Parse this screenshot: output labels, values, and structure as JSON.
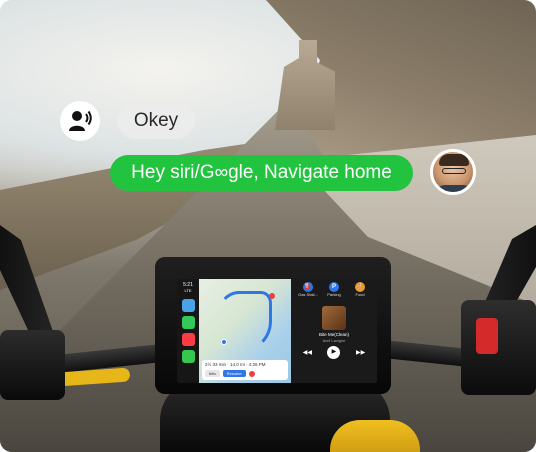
{
  "bubbles": {
    "okey": "Okey",
    "command": "Hey siri/G∞gle, Navigate home"
  },
  "device": {
    "status": {
      "time": "5:21",
      "network": "LTE"
    },
    "dock_icons": [
      "phone-icon",
      "music-icon",
      "maps-icon",
      "messages-icon"
    ],
    "map": {
      "eta": "2½ 33 min · 14.0 mi · 4:26 PM",
      "info_label": "Info",
      "resume_label": "Resume"
    },
    "quick_actions": [
      {
        "label": "Gas Stati...",
        "icon": "gas-station-icon",
        "glyph": "⛽",
        "color": "#2f76e6"
      },
      {
        "label": "Parking",
        "icon": "parking-icon",
        "glyph": "P",
        "color": "#2f76e6"
      },
      {
        "label": "Food",
        "icon": "food-icon",
        "glyph": "🍴",
        "color": "#f29a1e"
      }
    ],
    "now_playing": {
      "title": "Bite Me(Clean)",
      "artist": "Avril Lavigne"
    },
    "controls": {
      "prev": "◀◀",
      "play": "▶",
      "next": "▶▶"
    }
  },
  "colors": {
    "command_bubble": "#22c33f",
    "okey_bubble": "#ececec",
    "route": "#2f76e6"
  }
}
